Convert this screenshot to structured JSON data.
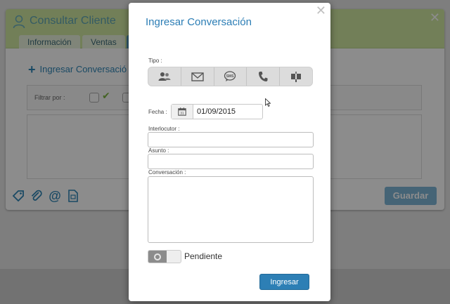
{
  "background": {
    "title": "Consultar Cliente",
    "close_glyph": "✕",
    "tabs": [
      "Información",
      "Ventas"
    ],
    "ingresar_link": "Ingresar Conversació",
    "filter_label": "Filtrar por :",
    "save_button": "Guardar",
    "bottom_icons": [
      "tag-icon",
      "paperclip-icon",
      "at-icon",
      "document-icon"
    ],
    "colors": {
      "header": "#cfe8a1",
      "accent": "#2f86b6"
    }
  },
  "modal": {
    "title": "Ingresar Conversación",
    "close_glyph": "✕",
    "tipo_label": "Tipo :",
    "types": [
      "contact-icon",
      "envelope-icon",
      "sms-icon",
      "phone-icon",
      "mailbox-icon"
    ],
    "fecha_label": "Fecha :",
    "fecha_value": "01/09/2015",
    "interlocutor_label": "Interlocutor :",
    "interlocutor_value": "",
    "asunto_label": "Asunto :",
    "asunto_value": "",
    "conversacion_label": "Conversación :",
    "conversacion_value": "",
    "pendiente_label": "Pendiente",
    "pendiente_on": false,
    "submit_label": "Ingresar",
    "colors": {
      "title": "#2b7db5",
      "button": "#2d7fb5"
    }
  }
}
